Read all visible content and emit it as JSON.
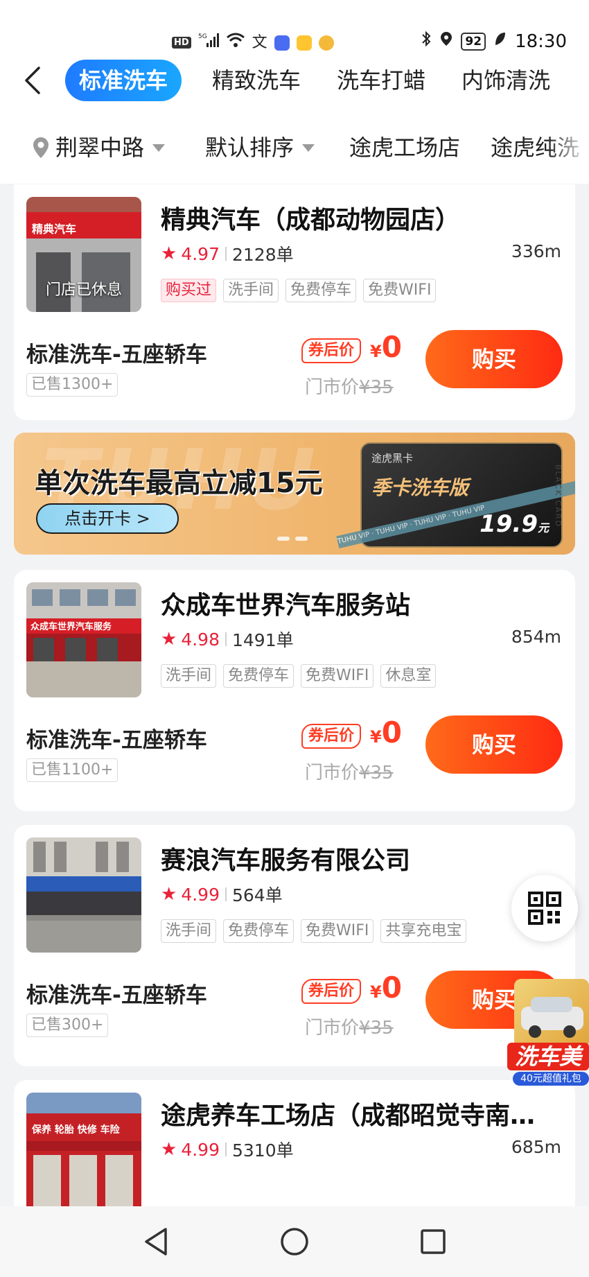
{
  "status_bar": {
    "network": "5G",
    "hd": "HD",
    "battery": "92",
    "time": "18:30"
  },
  "tabs": [
    {
      "label": "标准洗车",
      "active": true
    },
    {
      "label": "精致洗车",
      "active": false
    },
    {
      "label": "洗车打蜡",
      "active": false
    },
    {
      "label": "内饰清洗",
      "active": false
    }
  ],
  "filters": {
    "location": "荆翠中路",
    "sort": "默认排序",
    "shop_filter_1": "途虎工场店",
    "shop_filter_2": "途虎纯洗"
  },
  "shops": [
    {
      "name": "精典汽车（成都动物园店）",
      "rating": "4.97",
      "orders": "2128单",
      "distance": "336m",
      "closed_label": "门店已休息",
      "tags": [
        "购买过",
        "洗手间",
        "免费停车",
        "免费WIFI"
      ],
      "service": "标准洗车-五座轿车",
      "sold": "已售1300+",
      "coupon_label": "券后价",
      "currency": "¥",
      "price": "0",
      "store_price_label": "门市价",
      "store_price": "¥35",
      "buy_label": "购买"
    },
    {
      "name": "众成车世界汽车服务站",
      "rating": "4.98",
      "orders": "1491单",
      "distance": "854m",
      "tags": [
        "洗手间",
        "免费停车",
        "免费WIFI",
        "休息室"
      ],
      "service": "标准洗车-五座轿车",
      "sold": "已售1100+",
      "coupon_label": "券后价",
      "currency": "¥",
      "price": "0",
      "store_price_label": "门市价",
      "store_price": "¥35",
      "buy_label": "购买"
    },
    {
      "name": "赛浪汽车服务有限公司",
      "rating": "4.99",
      "orders": "564单",
      "distance": "",
      "tags": [
        "洗手间",
        "免费停车",
        "免费WIFI",
        "共享充电宝"
      ],
      "service": "标准洗车-五座轿车",
      "sold": "已售300+",
      "coupon_label": "券后价",
      "currency": "¥",
      "price": "0",
      "store_price_label": "门市价",
      "store_price": "¥35",
      "buy_label": "购买"
    },
    {
      "name": "途虎养车工场店（成都昭觉寺南…",
      "rating": "4.99",
      "orders": "5310单",
      "distance": "685m"
    }
  ],
  "banner": {
    "title": "单次洗车最高立减15元",
    "button": "点击开卡 >",
    "card_brand": "途虎黑卡",
    "card_name": "季卡洗车版",
    "card_price": "19.9",
    "card_price_unit": "元",
    "card_side_text": "BLACK CARD",
    "ribbon_text": "TUHU VIP · TUHU VIP · TUHU VIP · TUHU VIP"
  },
  "promo": {
    "title": "洗车美",
    "subtitle": "40元超值礼包"
  },
  "colors": {
    "accent_blue": "#1e7bff",
    "price_red": "#ff3d24",
    "rating_red": "#e8223a"
  }
}
